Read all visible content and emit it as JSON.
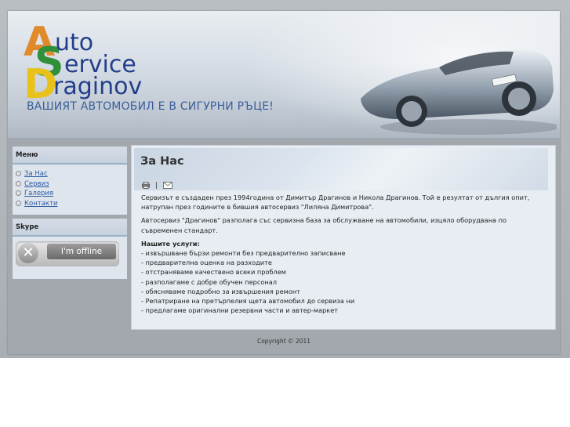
{
  "header": {
    "logo_letters": {
      "a": "A",
      "s": "S",
      "d": "D"
    },
    "logo_words": {
      "uto": "uto",
      "ervice": "ervice",
      "raginov": "raginov"
    },
    "slogan": "ВАШИЯТ АВТОМОБИЛ Е В СИГУРНИ РЪЦЕ!"
  },
  "sidebar": {
    "menu_title": "Меню",
    "menu_items": [
      {
        "label": "За Нас"
      },
      {
        "label": "Сервиз"
      },
      {
        "label": "Галерия"
      },
      {
        "label": "Контакти"
      }
    ],
    "skype_title": "Skype",
    "skype_status": "I'm offline"
  },
  "main": {
    "title": "За Нас",
    "icons": [
      "print-icon",
      "email-icon"
    ],
    "paragraph1": "Сервизът е създаден през 1994година от Димитър Драгинов и Никола Драгинов. Той е резултат от дългия опит, натрупан през годините в бившия автосервиз \"Лиляна Димитрова\".",
    "paragraph2": "Автосервиз \"Драгинов\" разполага със сервизна база за обслужване на автомобили, изцяло оборудвана по съвременен стандарт.",
    "services_title": "Нашите услуги:",
    "services": [
      "- извършване бързи ремонти без предварително записване",
      "- предварителна оценка на разходите",
      "- отстраняваме качествено всеки проблем",
      "- разполагаме с добре обучен персонал",
      "- обясняваме подробно за извършения ремонт",
      "- Репатриране на претърпелия щета автомобил до сервиза ни",
      "- предлагаме оригинални резервни части и автер-маркет"
    ]
  },
  "footer": {
    "copyright": "Copyright © 2011"
  }
}
